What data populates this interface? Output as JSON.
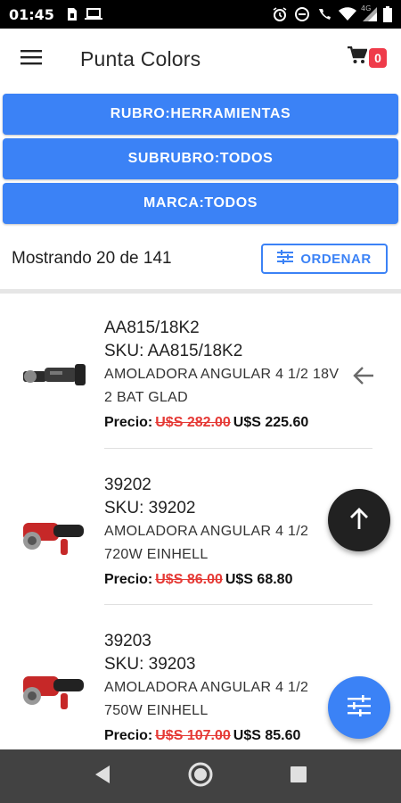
{
  "status_bar": {
    "time": "01:45",
    "network": "4G"
  },
  "app_bar": {
    "title": "Punta Colors",
    "cart_count": "0"
  },
  "filters": {
    "rubro": "RUBRO:HERRAMIENTAS",
    "subrubro": "SUBRUBRO:TODOS",
    "marca": "MARCA:TODOS"
  },
  "listing": {
    "count_text": "Mostrando 20 de 141",
    "order_label": "ORDENAR"
  },
  "products": [
    {
      "code": "AA815/18K2",
      "sku": "SKU: AA815/18K2",
      "desc_line1": "AMOLADORA ANGULAR 4 1/2 18V",
      "desc_line2": "2 BAT GLAD",
      "price_label": "Precio:",
      "old_price": "U$S 282.00",
      "new_price": "U$S 225.60"
    },
    {
      "code": "39202",
      "sku": "SKU: 39202",
      "desc_line1": "AMOLADORA ANGULAR 4 1/2",
      "desc_line2": "720W EINHELL",
      "price_label": "Precio:",
      "old_price": "U$S 86.00",
      "new_price": "U$S 68.80"
    },
    {
      "code": "39203",
      "sku": "SKU: 39203",
      "desc_line1": "AMOLADORA ANGULAR 4 1/2",
      "desc_line2": "750W EINHELL",
      "price_label": "Precio:",
      "old_price": "U$S 107.00",
      "new_price": "U$S 85.60"
    }
  ],
  "colors": {
    "accent": "#3b82f6",
    "old_price": "#e53935",
    "badge": "#ef3b4a",
    "fab_dark": "#212121",
    "navbar": "#424242"
  },
  "icons": [
    "menu-icon",
    "cart-icon",
    "tune-icon",
    "arrow-back-icon",
    "arrow-up-icon",
    "nav-back-icon",
    "nav-home-icon",
    "nav-recents-icon"
  ]
}
